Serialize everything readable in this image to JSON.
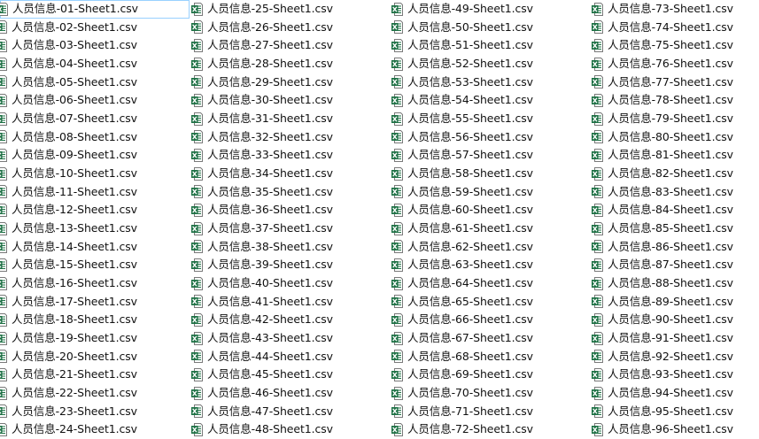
{
  "file_list": {
    "icon": "excel-csv-file-icon",
    "selected_index": 0,
    "files": [
      "人员信息-01-Sheet1.csv",
      "人员信息-02-Sheet1.csv",
      "人员信息-03-Sheet1.csv",
      "人员信息-04-Sheet1.csv",
      "人员信息-05-Sheet1.csv",
      "人员信息-06-Sheet1.csv",
      "人员信息-07-Sheet1.csv",
      "人员信息-08-Sheet1.csv",
      "人员信息-09-Sheet1.csv",
      "人员信息-10-Sheet1.csv",
      "人员信息-11-Sheet1.csv",
      "人员信息-12-Sheet1.csv",
      "人员信息-13-Sheet1.csv",
      "人员信息-14-Sheet1.csv",
      "人员信息-15-Sheet1.csv",
      "人员信息-16-Sheet1.csv",
      "人员信息-17-Sheet1.csv",
      "人员信息-18-Sheet1.csv",
      "人员信息-19-Sheet1.csv",
      "人员信息-20-Sheet1.csv",
      "人员信息-21-Sheet1.csv",
      "人员信息-22-Sheet1.csv",
      "人员信息-23-Sheet1.csv",
      "人员信息-24-Sheet1.csv",
      "人员信息-25-Sheet1.csv",
      "人员信息-26-Sheet1.csv",
      "人员信息-27-Sheet1.csv",
      "人员信息-28-Sheet1.csv",
      "人员信息-29-Sheet1.csv",
      "人员信息-30-Sheet1.csv",
      "人员信息-31-Sheet1.csv",
      "人员信息-32-Sheet1.csv",
      "人员信息-33-Sheet1.csv",
      "人员信息-34-Sheet1.csv",
      "人员信息-35-Sheet1.csv",
      "人员信息-36-Sheet1.csv",
      "人员信息-37-Sheet1.csv",
      "人员信息-38-Sheet1.csv",
      "人员信息-39-Sheet1.csv",
      "人员信息-40-Sheet1.csv",
      "人员信息-41-Sheet1.csv",
      "人员信息-42-Sheet1.csv",
      "人员信息-43-Sheet1.csv",
      "人员信息-44-Sheet1.csv",
      "人员信息-45-Sheet1.csv",
      "人员信息-46-Sheet1.csv",
      "人员信息-47-Sheet1.csv",
      "人员信息-48-Sheet1.csv",
      "人员信息-49-Sheet1.csv",
      "人员信息-50-Sheet1.csv",
      "人员信息-51-Sheet1.csv",
      "人员信息-52-Sheet1.csv",
      "人员信息-53-Sheet1.csv",
      "人员信息-54-Sheet1.csv",
      "人员信息-55-Sheet1.csv",
      "人员信息-56-Sheet1.csv",
      "人员信息-57-Sheet1.csv",
      "人员信息-58-Sheet1.csv",
      "人员信息-59-Sheet1.csv",
      "人员信息-60-Sheet1.csv",
      "人员信息-61-Sheet1.csv",
      "人员信息-62-Sheet1.csv",
      "人员信息-63-Sheet1.csv",
      "人员信息-64-Sheet1.csv",
      "人员信息-65-Sheet1.csv",
      "人员信息-66-Sheet1.csv",
      "人员信息-67-Sheet1.csv",
      "人员信息-68-Sheet1.csv",
      "人员信息-69-Sheet1.csv",
      "人员信息-70-Sheet1.csv",
      "人员信息-71-Sheet1.csv",
      "人员信息-72-Sheet1.csv",
      "人员信息-73-Sheet1.csv",
      "人员信息-74-Sheet1.csv",
      "人员信息-75-Sheet1.csv",
      "人员信息-76-Sheet1.csv",
      "人员信息-77-Sheet1.csv",
      "人员信息-78-Sheet1.csv",
      "人员信息-79-Sheet1.csv",
      "人员信息-80-Sheet1.csv",
      "人员信息-81-Sheet1.csv",
      "人员信息-82-Sheet1.csv",
      "人员信息-83-Sheet1.csv",
      "人员信息-84-Sheet1.csv",
      "人员信息-85-Sheet1.csv",
      "人员信息-86-Sheet1.csv",
      "人员信息-87-Sheet1.csv",
      "人员信息-88-Sheet1.csv",
      "人员信息-89-Sheet1.csv",
      "人员信息-90-Sheet1.csv",
      "人员信息-91-Sheet1.csv",
      "人员信息-92-Sheet1.csv",
      "人员信息-93-Sheet1.csv",
      "人员信息-94-Sheet1.csv",
      "人员信息-95-Sheet1.csv",
      "人员信息-96-Sheet1.csv"
    ]
  },
  "colors": {
    "icon_green": "#1e7145",
    "icon_page": "#ffffff",
    "icon_outline": "#7a7a7a",
    "selection_border": "#99d1ff",
    "text": "#111111",
    "background": "#ffffff"
  }
}
